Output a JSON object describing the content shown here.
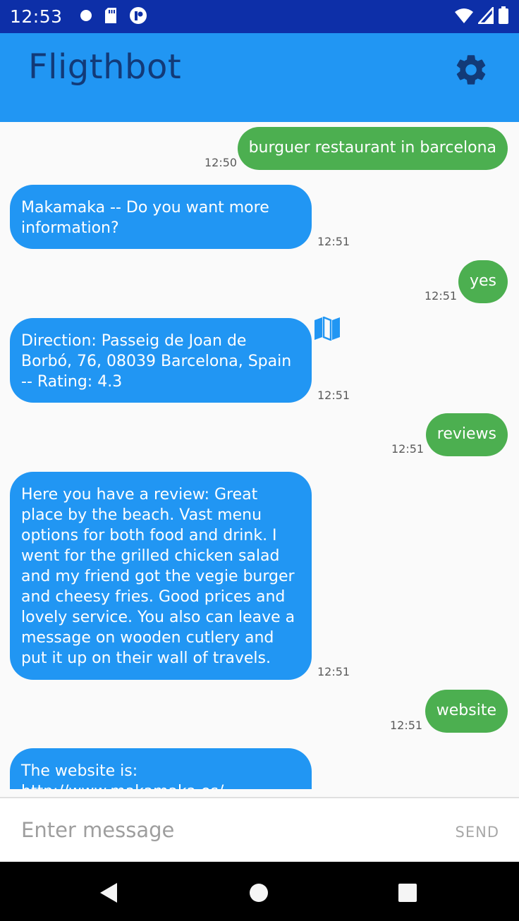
{
  "status_bar": {
    "time": "12:53"
  },
  "app_bar": {
    "title": "Fligthbot",
    "settings_icon": "gear-icon"
  },
  "colors": {
    "status_bar": "#0d2fa8",
    "app_bar": "#2196f3",
    "user_bubble": "#4caf50",
    "bot_bubble": "#2196f3"
  },
  "messages": [
    {
      "sender": "user",
      "text": "burguer restaurant in barcelona",
      "time": "12:50"
    },
    {
      "sender": "bot",
      "text": "Makamaka -- Do you want more information?",
      "time": "12:51"
    },
    {
      "sender": "user",
      "text": "yes",
      "time": "12:51"
    },
    {
      "sender": "bot",
      "text": "Direction: Passeig de Joan de Borbó, 76, 08039 Barcelona, Spain -- Rating: 4.3",
      "time": "12:51",
      "icon": "map-icon"
    },
    {
      "sender": "user",
      "text": "reviews",
      "time": "12:51"
    },
    {
      "sender": "bot",
      "text": "Here you have a review: Great place by the beach. Vast menu options for both food and drink. I went for the grilled chicken salad and my friend got the vegie burger and cheesy fries. Good prices and lovely service. You also can leave a message on wooden cutlery and put it up on their wall of travels.",
      "time": "12:51"
    },
    {
      "sender": "user",
      "text": "website",
      "time": "12:51"
    },
    {
      "sender": "bot",
      "text": "The website is: http://www.makamaka.es/"
    }
  ],
  "input": {
    "placeholder": "Enter message",
    "value": "",
    "send_label": "SEND"
  },
  "nav": {
    "back_icon": "back-icon",
    "home_icon": "home-icon",
    "recents_icon": "recents-icon"
  }
}
